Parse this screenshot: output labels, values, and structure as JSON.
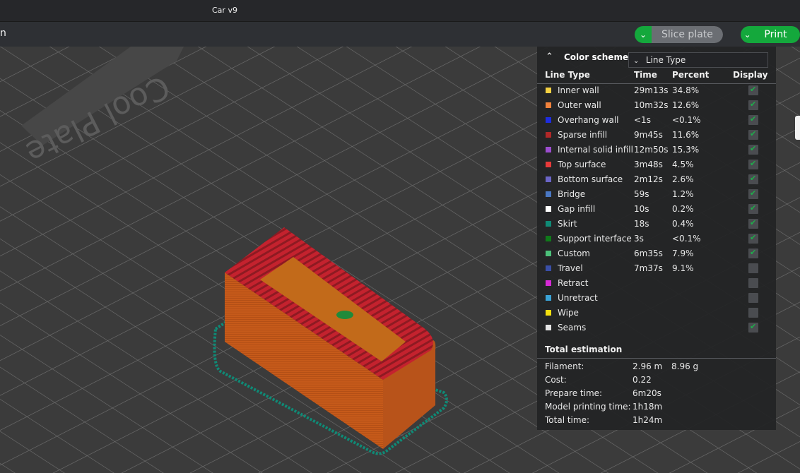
{
  "window": {
    "title": "Car v9"
  },
  "toolbar": {
    "left_text": "n",
    "slice_label": "Slice plate",
    "print_label": "Print p"
  },
  "plate": {
    "label": "Cool Plate"
  },
  "colors": {
    "accent": "#14a83c",
    "model": "#c25a1b",
    "top": "#b3222e",
    "skirt": "#0f8a76",
    "bed": "#3a3a3a"
  },
  "panel": {
    "color_scheme_label": "Color scheme",
    "scheme_value": "Line Type",
    "headers": {
      "type": "Line Type",
      "time": "Time",
      "percent": "Percent",
      "display": "Display"
    },
    "rows": [
      {
        "name": "Inner wall",
        "time": "29m13s",
        "percent": "34.8%",
        "color": "#f5d142",
        "display": true
      },
      {
        "name": "Outer wall",
        "time": "10m32s",
        "percent": "12.6%",
        "color": "#f0823c",
        "display": true
      },
      {
        "name": "Overhang wall",
        "time": "<1s",
        "percent": "<0.1%",
        "color": "#1e2de0",
        "display": true
      },
      {
        "name": "Sparse infill",
        "time": "9m45s",
        "percent": "11.6%",
        "color": "#b02828",
        "display": true
      },
      {
        "name": "Internal solid infill",
        "time": "12m50s",
        "percent": "15.3%",
        "color": "#9c4dcf",
        "display": true
      },
      {
        "name": "Top surface",
        "time": "3m48s",
        "percent": "4.5%",
        "color": "#e83a3a",
        "display": true
      },
      {
        "name": "Bottom surface",
        "time": "2m12s",
        "percent": "2.6%",
        "color": "#6b65c7",
        "display": true
      },
      {
        "name": "Bridge",
        "time": "59s",
        "percent": "1.2%",
        "color": "#4a78c4",
        "display": true
      },
      {
        "name": "Gap infill",
        "time": "10s",
        "percent": "0.2%",
        "color": "#ffffff",
        "display": true
      },
      {
        "name": "Skirt",
        "time": "18s",
        "percent": "0.4%",
        "color": "#0f8a76",
        "display": true
      },
      {
        "name": "Support interface",
        "time": "3s",
        "percent": "<0.1%",
        "color": "#0f7a1a",
        "display": true
      },
      {
        "name": "Custom",
        "time": "6m35s",
        "percent": "7.9%",
        "color": "#4cc17a",
        "display": true
      },
      {
        "name": "Travel",
        "time": "7m37s",
        "percent": "9.1%",
        "color": "#3a4fa8",
        "display": false
      },
      {
        "name": "Retract",
        "time": "",
        "percent": "",
        "color": "#d62ad6",
        "display": false
      },
      {
        "name": "Unretract",
        "time": "",
        "percent": "",
        "color": "#3aa3d6",
        "display": false
      },
      {
        "name": "Wipe",
        "time": "",
        "percent": "",
        "color": "#f5e00f",
        "display": false
      },
      {
        "name": "Seams",
        "time": "",
        "percent": "",
        "color": "#e6e6e6",
        "display": true
      }
    ],
    "total": {
      "label": "Total estimation",
      "rows": [
        {
          "key": "Filament:",
          "v1": "2.96 m",
          "v2": "8.96 g"
        },
        {
          "key": "Cost:",
          "v1": "0.22",
          "v2": ""
        },
        {
          "key": "Prepare time:",
          "v1": "6m20s",
          "v2": ""
        },
        {
          "key": "Model printing time:",
          "v1": "1h18m",
          "v2": ""
        },
        {
          "key": "Total time:",
          "v1": "1h24m",
          "v2": ""
        }
      ]
    }
  }
}
